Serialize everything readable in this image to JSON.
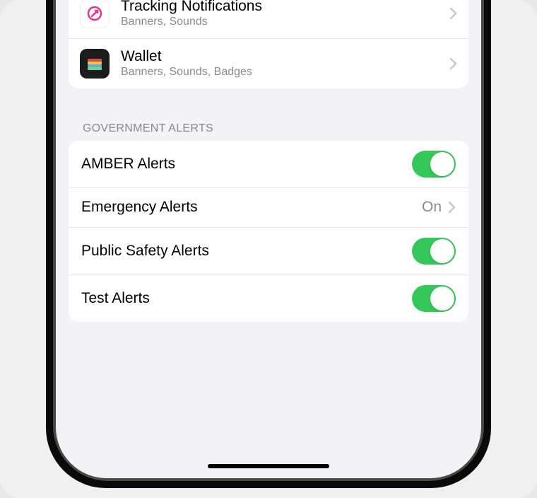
{
  "apps_section": {
    "items": [
      {
        "title": "Tracking Notifications",
        "subtitle": "Banners, Sounds",
        "icon": "tracking"
      },
      {
        "title": "Wallet",
        "subtitle": "Banners, Sounds, Badges",
        "icon": "wallet"
      }
    ]
  },
  "government_alerts": {
    "header": "GOVERNMENT ALERTS",
    "items": [
      {
        "label": "AMBER Alerts",
        "type": "toggle",
        "value": true
      },
      {
        "label": "Emergency Alerts",
        "type": "link",
        "value_text": "On"
      },
      {
        "label": "Public Safety Alerts",
        "type": "toggle",
        "value": true
      },
      {
        "label": "Test Alerts",
        "type": "toggle",
        "value": true
      }
    ]
  }
}
